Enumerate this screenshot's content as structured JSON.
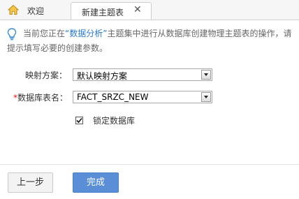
{
  "tabs": {
    "home_label": "欢迎",
    "active_label": "新建主题表",
    "close_glyph": "✕"
  },
  "hint": {
    "prefix": "当前您正在",
    "quote_open": "“",
    "set_name": "数据分析",
    "quote_close": "”",
    "suffix": "主题集中进行从数据库创建物理主题表的操作，请",
    "line2": "提示填写必要的创建参数。"
  },
  "form": {
    "mapping_label": "映射方案：",
    "mapping_value": "默认映射方案",
    "required_mark": "*",
    "table_label": "数据库表名：",
    "table_value": "FACT_SRZC_NEW",
    "lock_label": "锁定数据库",
    "lock_checked": true
  },
  "buttons": {
    "prev": "上一步",
    "done": "完成"
  },
  "colors": {
    "accent": "#5a8fd8",
    "highlight": "#2a7ad2",
    "required": "#ee1111"
  }
}
